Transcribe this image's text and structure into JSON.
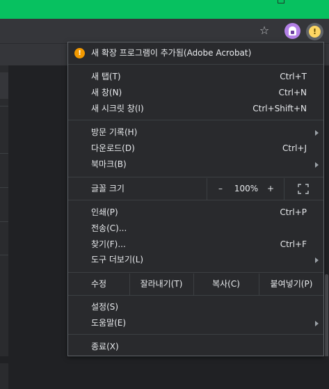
{
  "browser": {
    "toolbar_icons": [
      "star-icon",
      "extension-icon",
      "alert-icon"
    ],
    "colors": {
      "titlebar": "#07c160",
      "toolbar": "#35363a",
      "menu_bg": "#292a2d",
      "alert": "#f29900"
    }
  },
  "menu": {
    "notice": {
      "icon": "!",
      "label": "새 확장 프로그램이 추가됨(Adobe Acrobat)"
    },
    "items": {
      "new_tab": {
        "label": "새 탭(T)",
        "shortcut": "Ctrl+T"
      },
      "new_window": {
        "label": "새 창(N)",
        "shortcut": "Ctrl+N"
      },
      "incognito": {
        "label": "새 시크릿 창(I)",
        "shortcut": "Ctrl+Shift+N"
      },
      "history": {
        "label": "방문 기록(H)"
      },
      "downloads": {
        "label": "다운로드(D)",
        "shortcut": "Ctrl+J"
      },
      "bookmarks": {
        "label": "북마크(B)"
      },
      "print": {
        "label": "인쇄(P)",
        "shortcut": "Ctrl+P"
      },
      "cast": {
        "label": "전송(C)..."
      },
      "find": {
        "label": "찾기(F)...",
        "shortcut": "Ctrl+F"
      },
      "more_tools": {
        "label": "도구 더보기(L)"
      },
      "settings": {
        "label": "설정(S)"
      },
      "help": {
        "label": "도움말(E)"
      },
      "exit": {
        "label": "종료(X)"
      }
    },
    "zoom": {
      "label": "글꼴 크기",
      "minus": "–",
      "value": "100%",
      "plus": "+"
    },
    "edit": {
      "label": "수정",
      "cut": "잘라내기(T)",
      "copy": "복사(C)",
      "paste": "붙여넣기(P)"
    }
  }
}
